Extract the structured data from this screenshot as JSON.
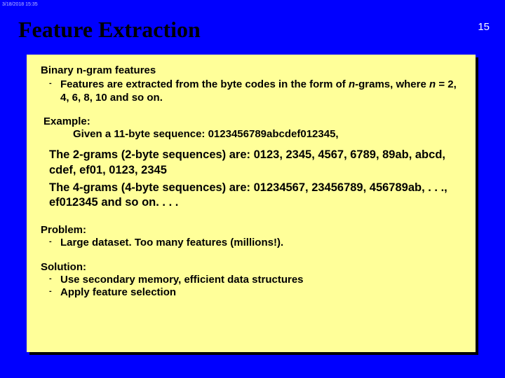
{
  "timestamp": "3/18/2018  15:35",
  "title": "Feature Extraction",
  "page_number": "15",
  "content": {
    "section1_heading": "Binary n-gram features",
    "section1_bullet_pre": "Features are extracted from the byte codes in the form of ",
    "section1_bullet_n": "n",
    "section1_bullet_post1": "-grams,  where ",
    "section1_bullet_n2": "n",
    "section1_bullet_post2": " = 2, 4, 6, 8, 10 and so on.",
    "example_label": "Example:",
    "example_text": "Given a 11-byte sequence: 0123456789abcdef012345,",
    "grams2_label": "The 2-grams (2-byte sequences) are: ",
    "grams2_values": "0123, 2345, 4567, 6789, 89ab, abcd, cdef, ef01, 0123, 2345",
    "grams4_label": "The 4-grams (4-byte sequences) are: ",
    "grams4_values": "01234567, 23456789, 456789ab, . . ., ef012345 and so on. . . .",
    "problem_label": "Problem:",
    "problem_bullet": "Large dataset. Too many features (millions!).",
    "solution_label": "Solution:",
    "solution_bullet1": "Use secondary memory, efficient data structures",
    "solution_bullet2": "Apply feature selection"
  }
}
